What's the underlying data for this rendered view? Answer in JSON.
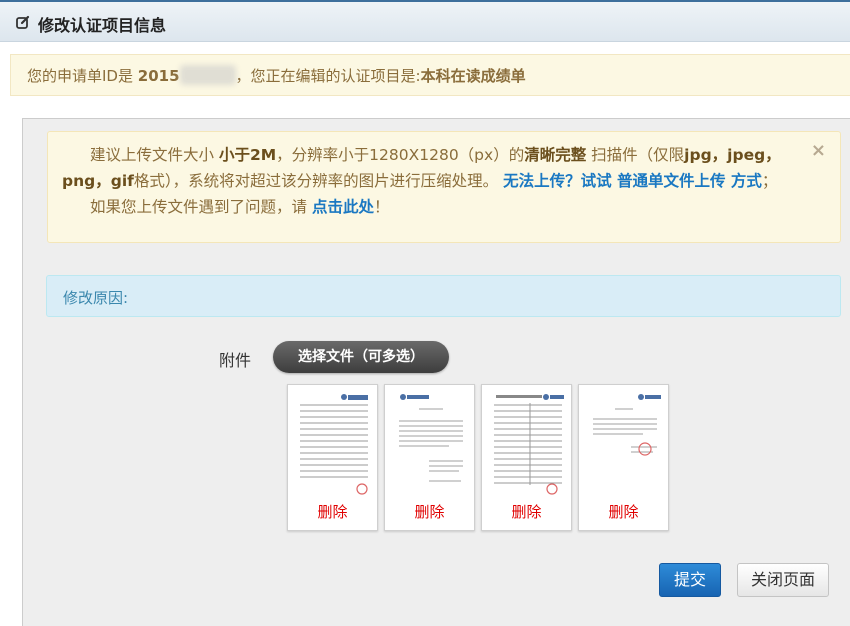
{
  "header": {
    "title": "修改认证项目信息",
    "icon": "edit-icon"
  },
  "info": {
    "prefix": "您的申请单ID是",
    "id_prefix": "2015",
    "middle": "，您正在编辑的认证项目是:",
    "project": "本科在读成绩单"
  },
  "tips": {
    "p1_a": "建议上传文件大小",
    "p1_b": "小于2M",
    "p1_c": "，分辨率小于1280X1280（px）的",
    "p1_d": "清晰完整",
    "p1_e": "扫描件（仅限",
    "p1_f": "jpg，jpeg，png，gif",
    "p1_g": "格式），系统将对超过该分辨率的图片进行压缩处理。",
    "link1": "无法上传？试试 普通单文件上传 方式",
    "p1_h": "；",
    "p2_a": "如果您上传文件遇到了问题，请",
    "link2": "点击此处",
    "p2_b": "！",
    "close": "×"
  },
  "reason": {
    "label": "修改原因:"
  },
  "attachment": {
    "label": "附件",
    "choose_button": "选择文件（可多选）",
    "files": [
      {
        "delete_label": "删除"
      },
      {
        "delete_label": "删除"
      },
      {
        "delete_label": "删除"
      },
      {
        "delete_label": "删除"
      }
    ]
  },
  "actions": {
    "submit": "提交",
    "close_page": "关闭页面"
  },
  "colors": {
    "submit_bg": "#1a6fc4",
    "delete_text": "#e00000",
    "tip_link": "#1a78c2"
  }
}
